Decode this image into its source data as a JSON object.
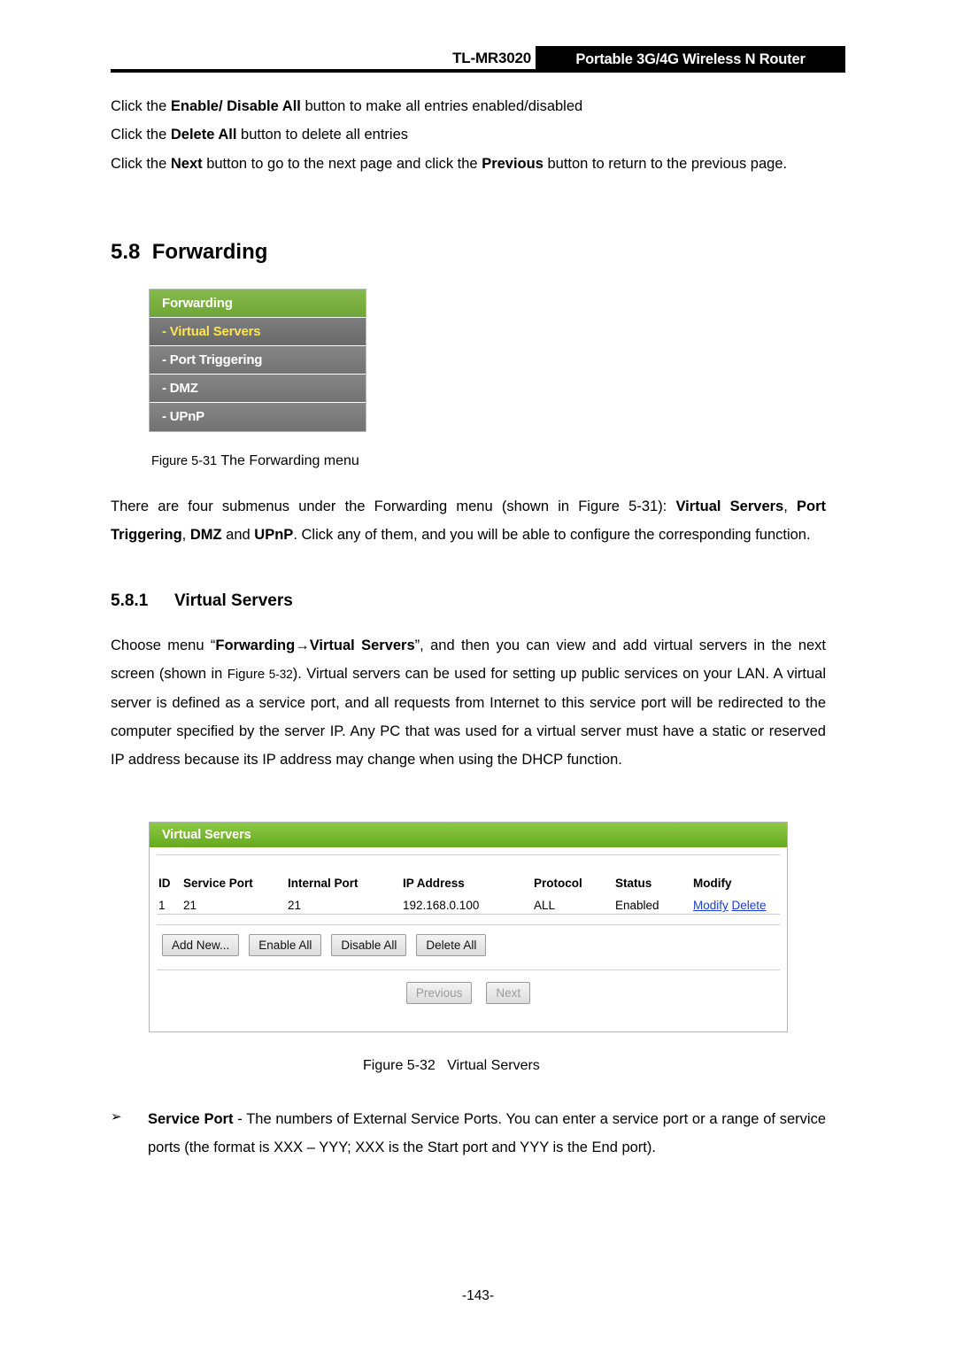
{
  "header": {
    "model": "TL-MR3020",
    "product": "Portable 3G/4G Wireless N Router"
  },
  "intro": {
    "line1_pre": "Click the ",
    "line1_bold": "Enable/ Disable All",
    "line1_post": " button to make all entries enabled/disabled",
    "line2_pre": "Click the ",
    "line2_bold": "Delete All",
    "line2_post": " button to delete all entries",
    "line3_pre": "Click the ",
    "line3_bold1": "Next",
    "line3_mid": " button to go to the next page and click the ",
    "line3_bold2": "Previous",
    "line3_post": " button to return to the previous page."
  },
  "section": {
    "number": "5.8",
    "title": "Forwarding"
  },
  "forwarding_menu": {
    "header_label": "Forwarding",
    "items": [
      {
        "label": "- Virtual Servers",
        "selected": true
      },
      {
        "label": "- Port Triggering",
        "selected": false
      },
      {
        "label": "- DMZ",
        "selected": false
      },
      {
        "label": "- UPnP",
        "selected": false
      }
    ]
  },
  "figure31": {
    "number": "Figure 5-31",
    "caption": "The Forwarding menu"
  },
  "para_forwarding": {
    "t1": "There are four submenus under the Forwarding menu (shown in ",
    "t2": "Figure 5-31",
    "t3": "): ",
    "b1": "Virtual Servers",
    "t4": ", ",
    "b2": "Port Triggering",
    "t5": ", ",
    "b3": "DMZ",
    "t6": " and ",
    "b4": "UPnP",
    "t7": ". Click any of them, and you will be able to configure the corresponding function."
  },
  "subsection": {
    "number": "5.8.1",
    "title": "Virtual Servers"
  },
  "para_virtual": {
    "t1": "Choose menu “",
    "b1": "Forwarding",
    "arrow": "→",
    "b2": "Virtual Servers",
    "t2": "”, and then you can view and add virtual servers in the next screen (shown in ",
    "small1": "Figure",
    "small2": "5-32",
    "t3": "). Virtual servers can be used for setting up public services on your LAN. A virtual server is defined as a service port, and all requests from Internet to this service port will be redirected to the computer specified by the server IP. Any PC that was used for a virtual server must have a static or reserved IP address because its IP address may change when using the DHCP function."
  },
  "virtual_servers_panel": {
    "title": "Virtual Servers",
    "columns": [
      "ID",
      "Service Port",
      "Internal Port",
      "IP Address",
      "Protocol",
      "Status",
      "Modify"
    ],
    "rows": [
      {
        "id": "1",
        "service_port": "21",
        "internal_port": "21",
        "ip_address": "192.168.0.100",
        "protocol": "ALL",
        "status": "Enabled",
        "modify_edit": "Modify",
        "modify_delete": "Delete"
      }
    ],
    "buttons": [
      "Add New...",
      "Enable All",
      "Disable All",
      "Delete All"
    ],
    "nav_buttons": [
      "Previous",
      "Next"
    ]
  },
  "figure32": {
    "number": "Figure 5-32",
    "caption": "Virtual Servers"
  },
  "bullet": {
    "marker": "➢",
    "bold": "Service Port",
    "text": " - The numbers of External Service Ports. You can enter a service port or a range of service ports (the format is XXX – YYY; XXX is the Start port and YYY is the End port)."
  },
  "footer": {
    "page": "-143-"
  }
}
